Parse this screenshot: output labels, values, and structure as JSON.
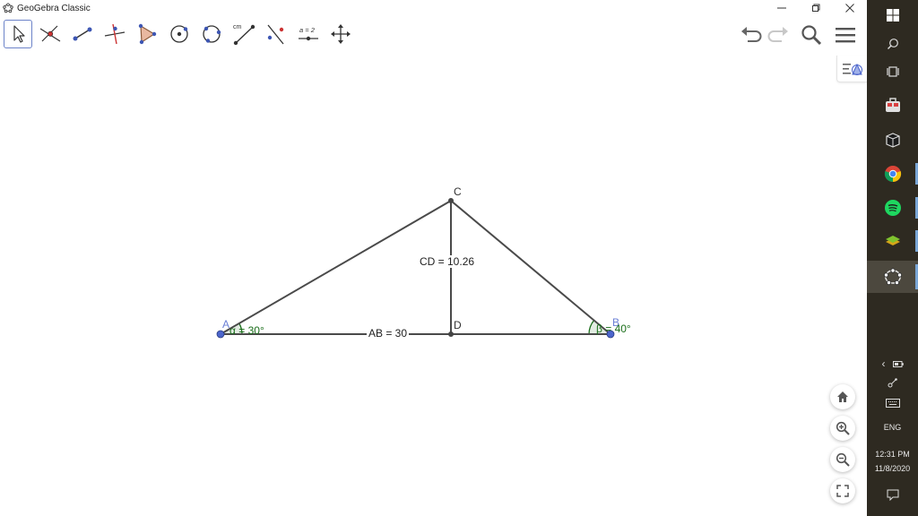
{
  "window": {
    "title": "GeoGebra Classic",
    "minimize_icon": "minimize-icon",
    "maximize_icon": "restore-icon",
    "close_icon": "close-icon"
  },
  "toolbar": {
    "tools": [
      {
        "name": "move-tool-icon",
        "active": true
      },
      {
        "name": "point-on-intersection-icon",
        "active": false
      },
      {
        "name": "segment-tool-icon",
        "active": false
      },
      {
        "name": "perpendicular-line-icon",
        "active": false
      },
      {
        "name": "polygon-tool-icon",
        "active": false
      },
      {
        "name": "circle-center-point-icon",
        "active": false
      },
      {
        "name": "circle-through-points-icon",
        "active": false
      },
      {
        "name": "distance-tool-icon",
        "active": false
      },
      {
        "name": "reflect-about-line-icon",
        "active": false
      },
      {
        "name": "slider-tool-icon",
        "active": false
      },
      {
        "name": "move-graphics-view-icon",
        "active": false
      }
    ],
    "distance_tool_text": "cm",
    "slider_tool_text": "a = 2",
    "right": [
      "undo-icon",
      "redo-icon",
      "search-icon",
      "menu-icon"
    ]
  },
  "graphics": {
    "points": {
      "A": "A",
      "B": "B",
      "C": "C",
      "D": "D"
    },
    "segment_labels": {
      "AB": "AB = 30",
      "CD": "CD = 10.26"
    },
    "angle_labels": {
      "alpha": "α = 30°",
      "beta": "β = 40°"
    },
    "colors": {
      "segment": "#4a4a4a",
      "free_point": "#4d66cc",
      "dependent_point": "#444444",
      "angle": "#1a6e1a"
    },
    "zoom_buttons": [
      "home-icon",
      "zoom-in-icon",
      "zoom-out-icon",
      "fullscreen-icon"
    ]
  },
  "taskbar": {
    "language": "ENG",
    "time": "12:31 PM",
    "date": "11/8/2020"
  }
}
